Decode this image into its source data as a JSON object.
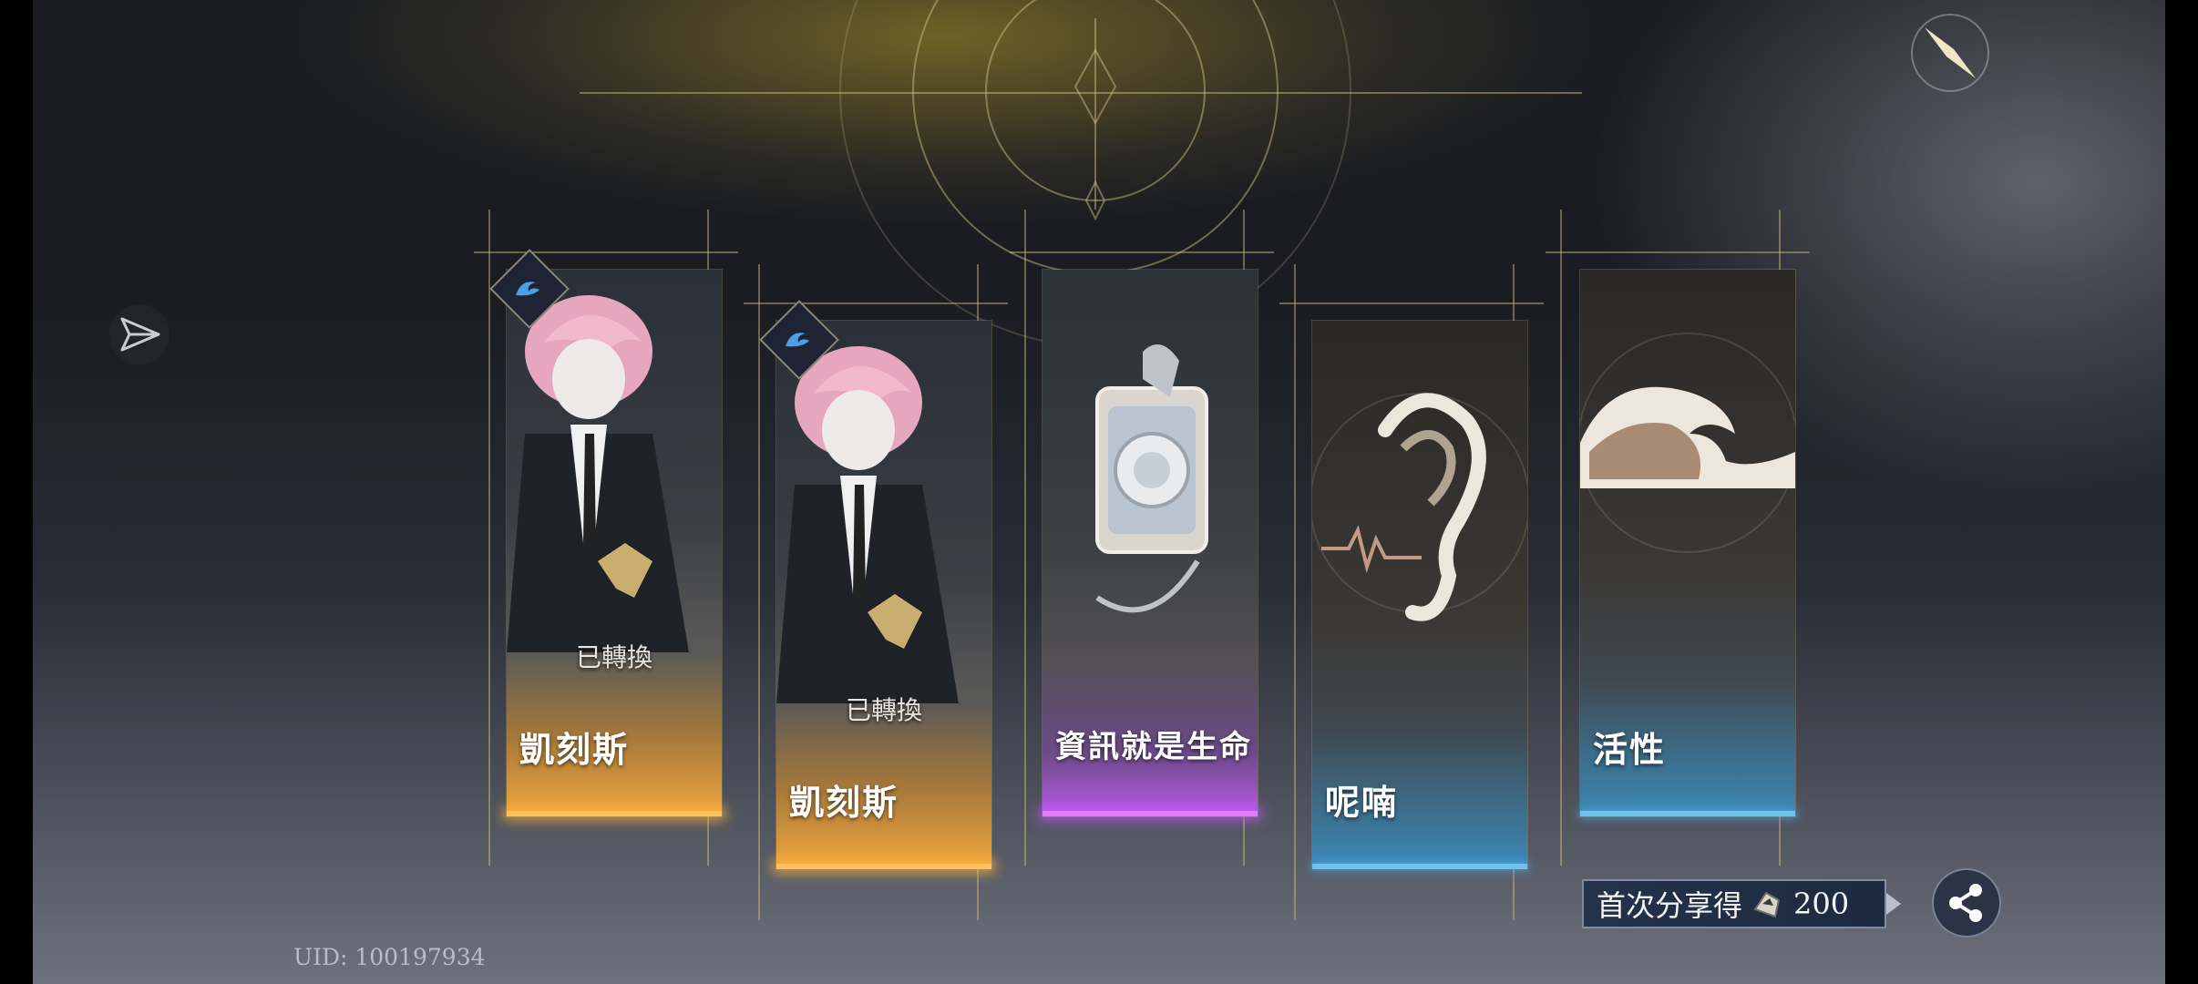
{
  "uid": "UID: 100197934",
  "cards": [
    {
      "name": "凱刻斯",
      "status": "已轉換",
      "rarity_color": "#f2a93b"
    },
    {
      "name": "凱刻斯",
      "status": "已轉換",
      "rarity_color": "#f2a93b"
    },
    {
      "name": "資訊就是生命",
      "rarity_color": "#c15bf0"
    },
    {
      "name": "呢喃",
      "rarity_color": "#3f9ad1"
    },
    {
      "name": "活性",
      "rarity_color": "#3f9ad1"
    }
  ],
  "share": {
    "text": "首次分享得",
    "reward_amount": "200",
    "reward_icon": "currency-icon"
  },
  "icons": {
    "close": "close-icon",
    "send": "send-icon",
    "share": "share-icon",
    "badge": "wave-emblem-icon"
  }
}
